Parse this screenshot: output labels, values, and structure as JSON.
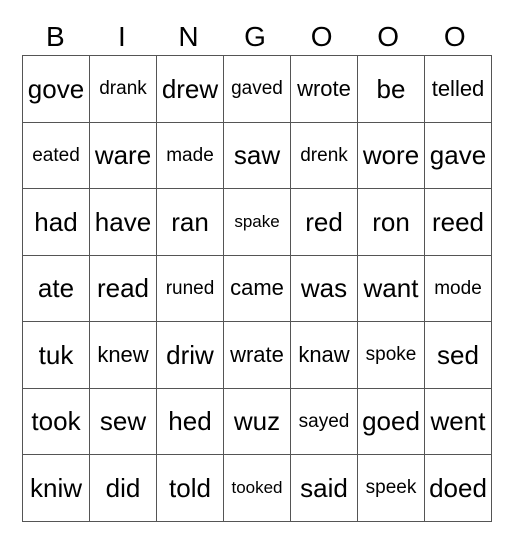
{
  "header": [
    "B",
    "I",
    "N",
    "G",
    "O",
    "O",
    "O"
  ],
  "rows": [
    [
      {
        "w": "gove",
        "s": "l"
      },
      {
        "w": "drank",
        "s": "s"
      },
      {
        "w": "drew",
        "s": "l"
      },
      {
        "w": "gaved",
        "s": "s"
      },
      {
        "w": "wrote",
        "s": "m"
      },
      {
        "w": "be",
        "s": "l"
      },
      {
        "w": "telled",
        "s": "m"
      }
    ],
    [
      {
        "w": "eated",
        "s": "s"
      },
      {
        "w": "ware",
        "s": "l"
      },
      {
        "w": "made",
        "s": "s"
      },
      {
        "w": "saw",
        "s": "l"
      },
      {
        "w": "drenk",
        "s": "s"
      },
      {
        "w": "wore",
        "s": "l"
      },
      {
        "w": "gave",
        "s": "l"
      }
    ],
    [
      {
        "w": "had",
        "s": "l"
      },
      {
        "w": "have",
        "s": "l"
      },
      {
        "w": "ran",
        "s": "l"
      },
      {
        "w": "spake",
        "s": "xs"
      },
      {
        "w": "red",
        "s": "l"
      },
      {
        "w": "ron",
        "s": "l"
      },
      {
        "w": "reed",
        "s": "l"
      }
    ],
    [
      {
        "w": "ate",
        "s": "l"
      },
      {
        "w": "read",
        "s": "l"
      },
      {
        "w": "runed",
        "s": "s"
      },
      {
        "w": "came",
        "s": "m"
      },
      {
        "w": "was",
        "s": "l"
      },
      {
        "w": "want",
        "s": "l"
      },
      {
        "w": "mode",
        "s": "s"
      }
    ],
    [
      {
        "w": "tuk",
        "s": "l"
      },
      {
        "w": "knew",
        "s": "m"
      },
      {
        "w": "driw",
        "s": "l"
      },
      {
        "w": "wrate",
        "s": "m"
      },
      {
        "w": "knaw",
        "s": "m"
      },
      {
        "w": "spoke",
        "s": "s"
      },
      {
        "w": "sed",
        "s": "l"
      }
    ],
    [
      {
        "w": "took",
        "s": "l"
      },
      {
        "w": "sew",
        "s": "l"
      },
      {
        "w": "hed",
        "s": "l"
      },
      {
        "w": "wuz",
        "s": "l"
      },
      {
        "w": "sayed",
        "s": "s"
      },
      {
        "w": "goed",
        "s": "l"
      },
      {
        "w": "went",
        "s": "l"
      }
    ],
    [
      {
        "w": "kniw",
        "s": "l"
      },
      {
        "w": "did",
        "s": "l"
      },
      {
        "w": "told",
        "s": "l"
      },
      {
        "w": "tooked",
        "s": "xs"
      },
      {
        "w": "said",
        "s": "l"
      },
      {
        "w": "speek",
        "s": "s"
      },
      {
        "w": "doed",
        "s": "l"
      }
    ]
  ]
}
